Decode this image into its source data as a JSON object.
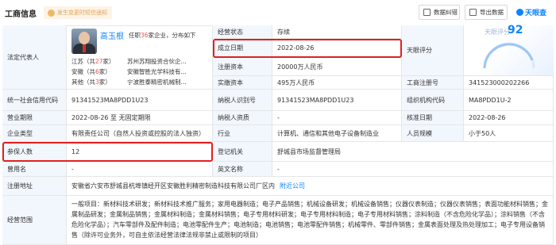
{
  "header": {
    "title": "工商信息",
    "hint": "发生变更时短信通知",
    "buttons": {
      "report": "数据纠错",
      "export": "导出数据"
    },
    "logo": "天眼查"
  },
  "legal_rep": {
    "label": "法定代表人",
    "name": "高玉根",
    "desc_prefix": "任职",
    "desc_count": "36",
    "desc_suffix": "家企业，分布如下",
    "regions": [
      {
        "province": "江苏",
        "count_text": "（共",
        "count": "27",
        "unit": "家）",
        "company": "苏州苏翔投资合伙企..."
      },
      {
        "province": "安徽",
        "count_text": "（共",
        "count": "6",
        "unit": "家）",
        "company": "安徽智胜光学科技有..."
      },
      {
        "province": "其他",
        "count_text": "（共",
        "count": "3",
        "unit": "家）",
        "company": "宁波胜泰精密机械制..."
      }
    ]
  },
  "fields": {
    "status_label": "经营状态",
    "status_value": "存续",
    "est_date_label": "成立日期",
    "est_date_value": "2022-08-26",
    "reg_capital_label": "注册资本",
    "reg_capital_value": "20000万人民币",
    "paid_capital_label": "实缴资本",
    "paid_capital_value": "495万人民币",
    "score_label": "天眼评分",
    "score_value": "92",
    "reg_no_label": "工商注册号",
    "reg_no_value": "341523000202266",
    "credit_code_label": "统一社会信用代码",
    "credit_code_value": "91341523MA8PDD1U23",
    "taxpayer_id_label": "纳税人识别号",
    "taxpayer_id_value": "91341523MA8PDD1U23",
    "org_code_label": "组织机构代码",
    "org_code_value": "MA8PDD1U-2",
    "term_label": "营业期限",
    "term_value": "2022-08-26 至 无固定期限",
    "taxpayer_qual_label": "纳税人资质",
    "taxpayer_qual_value": "-",
    "approval_label": "核准日期",
    "approval_value": "2022-08-26",
    "type_label": "企业类型",
    "type_value": "有限责任公司（自然人投资或控股的法人独资）",
    "industry_label": "行业",
    "industry_value": "计算机、通信和其他电子设备制造业",
    "staff_label": "人员规模",
    "staff_value": "小于50人",
    "insured_label": "参保人数",
    "insured_value": "12",
    "authority_label": "登记机关",
    "authority_value": "舒城县市场监督管理局",
    "former_label": "曾用名",
    "former_value": "-",
    "english_label": "英文名称",
    "english_value": "-",
    "address_label": "注册地址",
    "address_value": "安徽省六安市舒城县杭埠镇经开区安徽胜利精密制造科技有限公司厂区内",
    "address_link": "附近公司",
    "scope_label": "经营范围",
    "scope_value": "一般项目：新材料技术研发；新材料技术推广服务；家用电器制造；电子产品销售；机械设备研发；机械设备销售；仪器仪表制造；仪器仪表销售；表面功能材料销售；金属制品研发；金属制品销售；金属材料制造；金属材料销售；电子专用材料研发；电子专用材料制造；电子专用材料销售；涂料制造（不含危险化学品）；涂料销售（不含危险化学品）；汽车零部件及配件制造；电池零配件生产；电池制造；电池销售；电池零配件销售；机械零件、零部件销售；金属表面处理及热处理加工；电子专用设备销售（除许可业务外，可自主依法经营法律法规非禁止或限制的项目）"
  },
  "colors": {
    "accent": "#0d84ff",
    "highlight": "#e02020",
    "label_bg": "#f2f7fd"
  }
}
